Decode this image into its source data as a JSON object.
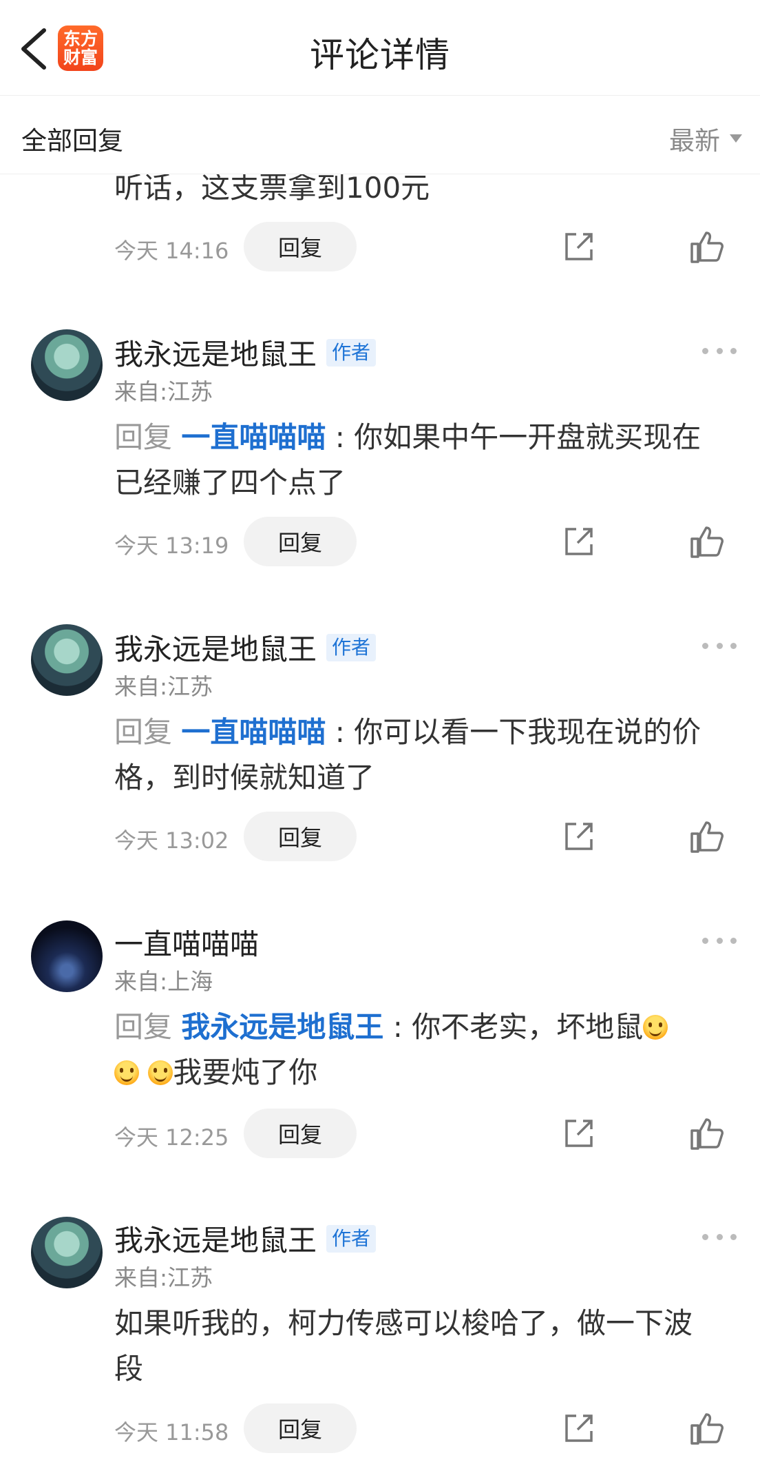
{
  "header": {
    "title": "评论详情",
    "logo_line1": "东方",
    "logo_line2": "财富"
  },
  "subbar": {
    "label": "全部回复",
    "sort_label": "最新"
  },
  "comments": [
    {
      "text": "听话，这支票拿到100元",
      "time": "今天 14:16",
      "reply_label": "回复"
    },
    {
      "name": "我永远是地鼠王",
      "badge": "作者",
      "location": "来自:江苏",
      "reply_prefix": "回复 ",
      "mention": "一直喵喵喵",
      "colon": " : ",
      "text": "你如果中午一开盘就买现在已经赚了四个点了",
      "time": "今天 13:19",
      "reply_label": "回复"
    },
    {
      "name": "我永远是地鼠王",
      "badge": "作者",
      "location": "来自:江苏",
      "reply_prefix": "回复 ",
      "mention": "一直喵喵喵",
      "colon": " : ",
      "text": "你可以看一下我现在说的价格，到时候就知道了",
      "time": "今天 13:02",
      "reply_label": "回复"
    },
    {
      "name": "一直喵喵喵",
      "location": "来自:上海",
      "reply_prefix": "回复 ",
      "mention": "我永远是地鼠王",
      "colon": " : ",
      "text_a": "你不老实，坏地鼠",
      "text_b": "我要炖了你",
      "time": "今天 12:25",
      "reply_label": "回复"
    },
    {
      "name": "我永远是地鼠王",
      "badge": "作者",
      "location": "来自:江苏",
      "text": "如果听我的，柯力传感可以梭哈了，做一下波段",
      "time": "今天 11:58",
      "reply_label": "回复"
    }
  ],
  "icons": {
    "back": "chevron-left-icon",
    "more": "more-dots-icon",
    "share": "share-icon",
    "like": "thumbs-up-icon",
    "emoji": "smile-emoji-icon"
  },
  "colors": {
    "accent": "#1e6fd0",
    "brand": "#f2441b",
    "muted": "#999999"
  }
}
